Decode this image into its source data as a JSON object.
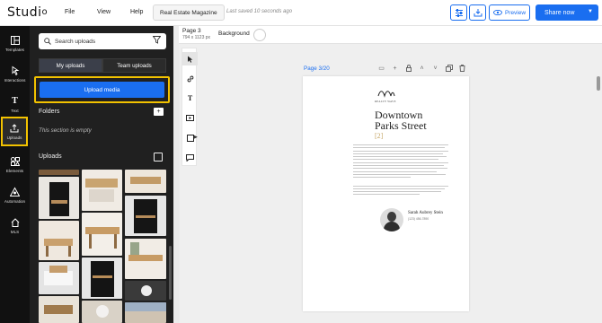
{
  "app": {
    "logo": "Studi"
  },
  "menu": [
    {
      "label": "File"
    },
    {
      "label": "View"
    },
    {
      "label": "Help"
    }
  ],
  "document": {
    "title": "Real Estate Magazine",
    "saved_status": "Last saved 10 seconds ago"
  },
  "toolbar": {
    "settings_icon": "sliders-icon",
    "download_icon": "download-icon",
    "preview_label": "Preview",
    "share_label": "Share now"
  },
  "rail": [
    {
      "label": "Templates",
      "icon": "templates-icon"
    },
    {
      "label": "Interactions",
      "icon": "interactions-icon"
    },
    {
      "label": "Text",
      "icon": "text-icon"
    },
    {
      "label": "Uploads",
      "icon": "upload-icon",
      "active": true
    },
    {
      "label": "Elements",
      "icon": "elements-icon"
    },
    {
      "label": "Automation",
      "icon": "automation-icon"
    },
    {
      "label": "MLS",
      "icon": "home-icon"
    }
  ],
  "panel": {
    "search_placeholder": "Search uploads",
    "tabs": [
      {
        "label": "My uploads",
        "active": true
      },
      {
        "label": "Team uploads",
        "active": false
      }
    ],
    "upload_button": "Upload media",
    "folders_heading": "Folders",
    "folders_empty": "This section is empty",
    "uploads_heading": "Uploads"
  },
  "editor": {
    "page_label": "Page 3",
    "page_dimensions": "794 x 1123 px",
    "background_label": "Background",
    "page_indicator": "Page 3/20"
  },
  "page_content": {
    "brand_name": "REALTY WAVE",
    "title_line1": "Downtown",
    "title_line2": "Parks Street",
    "bracket": "[2]",
    "agent_name": "Sarah Aubrey Stein",
    "agent_phone": "(123) 456-7890"
  },
  "colors": {
    "accent": "#1a6ef0",
    "highlight": "#f2c200",
    "panel_bg": "#202020",
    "rail_bg": "#111111"
  }
}
